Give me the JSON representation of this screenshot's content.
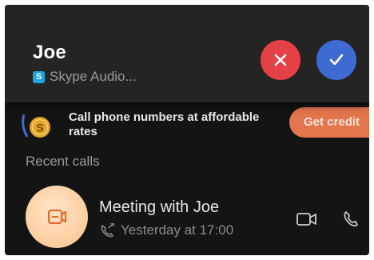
{
  "incoming_call": {
    "caller_name": "Joe",
    "source_label": "Skype Audio...",
    "decline_symbol": "✕",
    "accept_symbol": "✓",
    "decline_color": "#e64047",
    "accept_color": "#3f6ad2",
    "source_icon": "skype-icon"
  },
  "promo": {
    "text": "Call phone numbers at affordable rates",
    "button_label": "Get credit",
    "icon": "coin-icon",
    "accent_color": "#e2764d"
  },
  "recent_calls": {
    "title": "Recent calls",
    "items": [
      {
        "title": "Meeting with Joe",
        "detail": "Yesterday at 17:00",
        "avatar_icon": "meeting-icon",
        "detail_icon": "outgoing-call-icon",
        "actions": [
          "video-camera-icon",
          "phone-icon"
        ]
      }
    ]
  }
}
